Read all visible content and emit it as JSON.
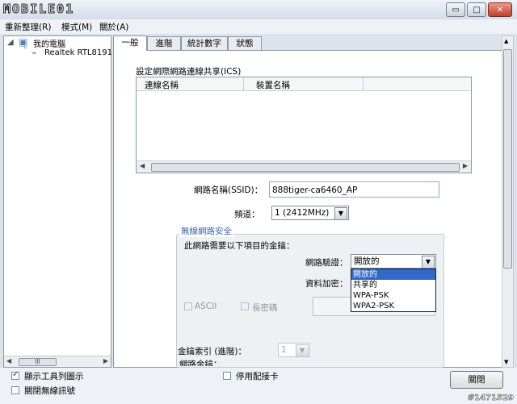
{
  "logo": "MOBILE01",
  "window": {
    "min": "▭",
    "max": "□",
    "close": "✕"
  },
  "menu": [
    "重新整理(R)",
    "模式(M)",
    "關於(A)"
  ],
  "tree": {
    "root": "我的電腦",
    "child": "Realtek RTL8191",
    "scroll_thumb": "|||"
  },
  "tabs": [
    "一般",
    "進階",
    "統計數字",
    "狀態"
  ],
  "ics": {
    "title": "設定網際網路連線共享(ICS)",
    "col1": "連線名稱",
    "col2": "裝置名稱"
  },
  "ssid": {
    "label": "網路名稱(SSID)：",
    "value": "888tiger-ca6460_AP"
  },
  "channel": {
    "label": "頻道：",
    "value": "1 (2412MHz)"
  },
  "security": {
    "group_title": "無線網路安全",
    "need_key": "此網路需要以下項目的金鑰：",
    "auth_label": "網路驗證：",
    "auth_value": "開放的",
    "auth_options": [
      "開放的",
      "共享的",
      "WPA-PSK",
      "WPA2-PSK"
    ],
    "encrypt_label": "資料加密：",
    "ascii": "ASCII",
    "long_key": "長密碼",
    "key_index_label": "金鑰索引 (進階)：",
    "key_index_value": "1",
    "key_label": "網路金鑰："
  },
  "bottom": {
    "show_tray": "顯示工具列圖示",
    "disable_adapter": "停用配接卡",
    "close_wireless": "關閉無線訊號",
    "close_button": "關閉"
  },
  "watermark": "#1471529"
}
